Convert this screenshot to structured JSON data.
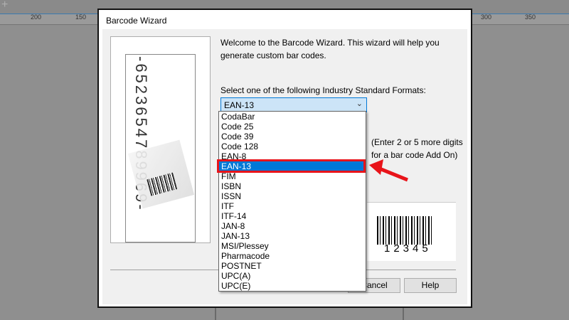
{
  "ruler": {
    "ticks": [
      "200",
      "150",
      "300",
      "350"
    ]
  },
  "dialog": {
    "title": "Barcode Wizard",
    "welcome": "Welcome to the Barcode Wizard.  This wizard will help you generate custom bar codes.",
    "select_label": "Select one of the following Industry Standard Formats:",
    "selected_format": "EAN-13",
    "image_digits": "-6523654789969-",
    "addon_line1": "(Enter 2 or 5 more digits",
    "addon_line2": "for a bar code Add On)",
    "preview_number": "12345",
    "cancel_label": "Cancel",
    "help_label": "Help",
    "formats": [
      "CodaBar",
      "Code 25",
      "Code 39",
      "Code 128",
      "EAN-8",
      "EAN-13",
      "FIM",
      "ISBN",
      "ISSN",
      "ITF",
      "ITF-14",
      "JAN-8",
      "JAN-13",
      "MSI/Plessey",
      "Pharmacode",
      "POSTNET",
      "UPC(A)",
      "UPC(E)"
    ],
    "highlighted_index": 5
  },
  "colors": {
    "highlight": "#0078d7",
    "annotation": "#e8141a"
  }
}
